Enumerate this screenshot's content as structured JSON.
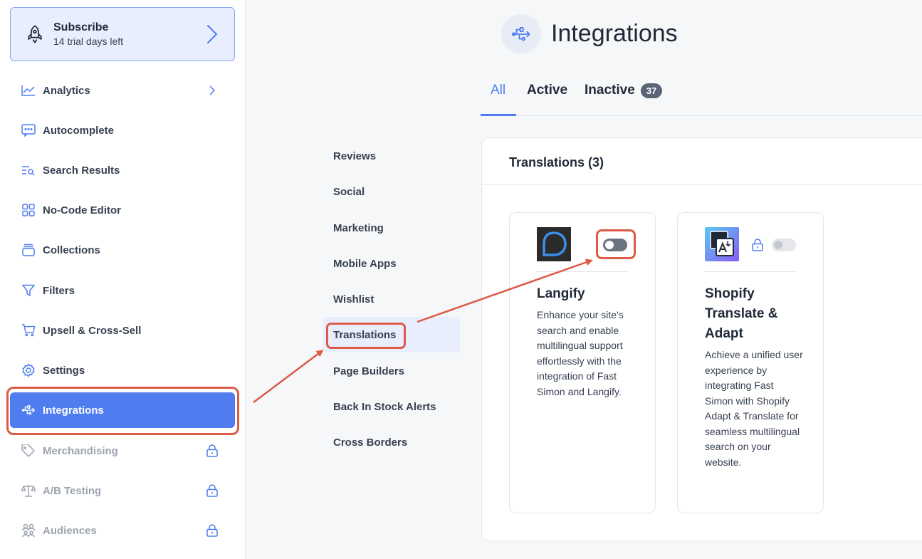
{
  "subscribe": {
    "title": "Subscribe",
    "subtitle": "14 trial days left"
  },
  "sidebar": {
    "items": [
      {
        "label": "Analytics",
        "icon": "chart-line-icon"
      },
      {
        "label": "Autocomplete",
        "icon": "message-dots-icon"
      },
      {
        "label": "Search Results",
        "icon": "list-search-icon"
      },
      {
        "label": "No-Code Editor",
        "icon": "grid-icon"
      },
      {
        "label": "Collections",
        "icon": "layers-icon"
      },
      {
        "label": "Filters",
        "icon": "filter-icon"
      },
      {
        "label": "Upsell & Cross-Sell",
        "icon": "cart-icon"
      },
      {
        "label": "Settings",
        "icon": "gear-icon"
      },
      {
        "label": "Integrations",
        "icon": "usb-icon"
      },
      {
        "label": "Merchandising",
        "icon": "tag-icon"
      },
      {
        "label": "A/B Testing",
        "icon": "scale-icon"
      },
      {
        "label": "Audiences",
        "icon": "users-icon"
      }
    ]
  },
  "header": {
    "title": "Integrations"
  },
  "tabs": {
    "all": "All",
    "active": "Active",
    "inactive": "Inactive",
    "inactive_count": "37"
  },
  "categories": [
    "Reviews",
    "Social",
    "Marketing",
    "Mobile Apps",
    "Wishlist",
    "Translations",
    "Page Builders",
    "Back In Stock Alerts",
    "Cross Borders"
  ],
  "panel": {
    "title": "Translations (3)"
  },
  "cards": [
    {
      "name": "Langify",
      "description": "Enhance your site's search and enable multilingual support effortlessly with the integration of Fast Simon and Langify.",
      "enabled": false,
      "locked": false
    },
    {
      "name": "Shopify Translate & Adapt",
      "description": "Achieve a unified user experience by integrating Fast Simon with Shopify Adapt & Translate for seamless multilingual search on your website.",
      "enabled": false,
      "locked": true
    }
  ],
  "colors": {
    "accent": "#4f7df0",
    "annotation": "#dc5a46",
    "toggle_off": "#6b7280",
    "toggle_locked": "#e5e7eb"
  }
}
